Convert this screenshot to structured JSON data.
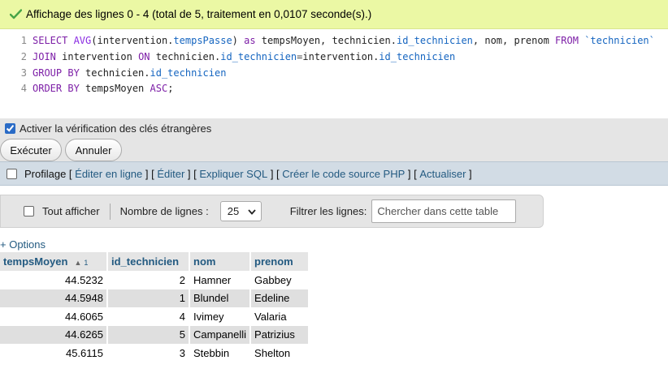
{
  "message": {
    "text": "Affichage des lignes 0 - 4 (total de 5, traitement en 0,0107 seconde(s).)",
    "icon": "check-icon"
  },
  "sql": {
    "line_numbers": [
      "1",
      "2",
      "3",
      "4"
    ],
    "l1": {
      "select": "SELECT ",
      "avg": "AVG",
      "p1": "(intervention.",
      "tempsPasse": "tempsPasse",
      "p2": ") ",
      "as": "as",
      "p3": " tempsMoyen, technicien.",
      "id": "id_technicien",
      "p4": ", nom, prenom ",
      "from": "FROM",
      "sp": " ",
      "table": "`technicien`"
    },
    "l2": {
      "join": "JOIN",
      "p1": " intervention ",
      "on": "ON",
      "p2": " technicien.",
      "id1": "id_technicien",
      "eq": "=",
      "p3": "intervention.",
      "id2": "id_technicien"
    },
    "l3": {
      "group": "GROUP BY",
      "p1": " technicien.",
      "id": "id_technicien"
    },
    "l4": {
      "order": "ORDER BY",
      "p1": " tempsMoyen ",
      "asc": "ASC",
      "p2": ";"
    }
  },
  "fk": {
    "label": "Activer la vérification des clés étrangères",
    "checked": true
  },
  "buttons": {
    "execute": "Exécuter",
    "cancel": "Annuler"
  },
  "profiling": {
    "label": "Profilage",
    "links": [
      "Éditer en ligne",
      "Éditer",
      "Expliquer SQL",
      "Créer le code source PHP",
      "Actualiser"
    ]
  },
  "nav": {
    "show_all": "Tout afficher",
    "rows_label": "Nombre de lignes :",
    "rows_value": "25",
    "filter_label": "Filtrer les lignes:",
    "filter_placeholder": "Chercher dans cette table"
  },
  "options_link": "+ Options",
  "table": {
    "headers": [
      "tempsMoyen",
      "id_technicien",
      "nom",
      "prenom"
    ],
    "sort_index": "1",
    "rows": [
      [
        "44.5232",
        "2",
        "Hamner",
        "Gabbey"
      ],
      [
        "44.5948",
        "1",
        "Blundel",
        "Edeline"
      ],
      [
        "44.6065",
        "4",
        "Ivimey",
        "Valaria"
      ],
      [
        "44.6265",
        "5",
        "Campanelli",
        "Patrizius"
      ],
      [
        "45.6115",
        "3",
        "Stebbin",
        "Shelton"
      ]
    ]
  }
}
